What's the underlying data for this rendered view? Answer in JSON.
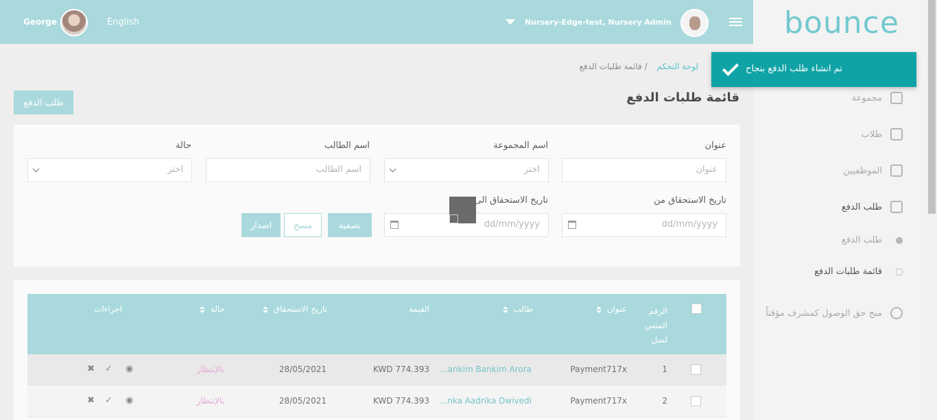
{
  "header": {
    "user_name": "George",
    "language": "English",
    "nursery_label": "Nursery-Edge-test, Nursery Admin"
  },
  "sidebar": {
    "logo_text": "bounce",
    "items": [
      {
        "label": "مجموعة"
      },
      {
        "label": "طلاب"
      },
      {
        "label": "الموظفيين"
      },
      {
        "label": "طلب الدفع"
      },
      {
        "label": "طلب الدفع"
      },
      {
        "label": "قائمة طلبات الدفع"
      },
      {
        "label": "منح حق الوصول كمشرف مؤقتاً"
      }
    ]
  },
  "toast": {
    "message": "تم انشاء طلب الدفع بنجاح"
  },
  "breadcrumb": {
    "home": "لوحة التحكم",
    "current": "قائمة طلبات الدفع"
  },
  "page": {
    "title": "قائمة طلبات الدفع",
    "create_button": "طلب الدفع"
  },
  "filters": {
    "title_label": "عنوان",
    "title_placeholder": "عنوان",
    "group_label": "اسم المجموعة",
    "group_value": "اختر",
    "student_label": "اسم الطالب",
    "student_placeholder": "اسم الطالب",
    "status_label": "حالة",
    "status_value": "اختر",
    "due_from_label": "تاريخ الاستحقاق من",
    "due_from_placeholder": "dd/mm/yyyy",
    "due_to_label": "تاريخ الاستحقاق الى",
    "due_to_placeholder": "dd/mm/yyyy",
    "filter_button": "تصفية",
    "clear_button": "مسح",
    "export_button": "اصدار"
  },
  "table": {
    "headers": {
      "serial": "الرقم المتس لسل",
      "title": "عنوان",
      "student": "طالب",
      "amount": "القيمة",
      "due_date": "تاريخ الاستحقاق",
      "status": "حالة",
      "actions": "اجراءات"
    },
    "rows": [
      {
        "serial": "1",
        "title": "Payment717x",
        "student": "...ankim Bankim Arora",
        "amount": "KWD 774.393",
        "due_date": "28/05/2021",
        "status": "بالإنتظار"
      },
      {
        "serial": "2",
        "title": "Payment717x",
        "student": "...nka Aadrika Dwivedi",
        "amount": "KWD 774.393",
        "due_date": "28/05/2021",
        "status": "بالإنتظار"
      }
    ]
  }
}
